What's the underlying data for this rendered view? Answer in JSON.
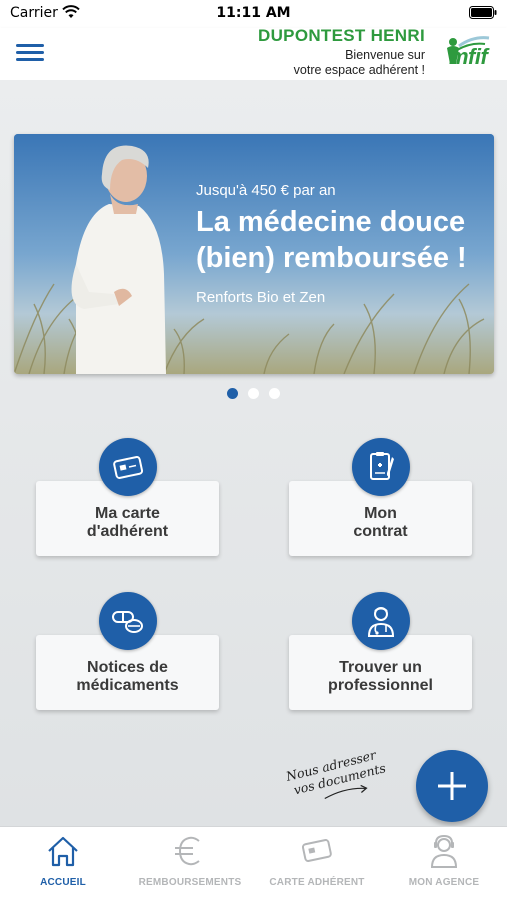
{
  "status_bar": {
    "carrier": "Carrier",
    "time": "11:11 AM"
  },
  "header": {
    "user_name": "DUPONTEST HENRI",
    "welcome_line1": "Bienvenue sur",
    "welcome_line2": "votre espace adhérent !",
    "logo_text": "mfif",
    "logo_color": "#2e9a3e"
  },
  "banner": {
    "kicker": "Jusqu'à 450 € par an",
    "title_line1": "La médecine douce",
    "title_line2": "(bien) remboursée !",
    "subtitle": "Renforts Bio et Zen",
    "pages": 3,
    "active_page": 1
  },
  "tiles": [
    {
      "label_line1": "Ma carte",
      "label_line2": "d'adhérent",
      "icon": "card-icon"
    },
    {
      "label_line1": "Mon",
      "label_line2": "contrat",
      "icon": "contract-icon"
    },
    {
      "label_line1": "Notices de",
      "label_line2": "médicaments",
      "icon": "pills-icon"
    },
    {
      "label_line1": "Trouver un",
      "label_line2": "professionnel",
      "icon": "doctor-icon"
    }
  ],
  "upload": {
    "hint_line1": "Nous adresser",
    "hint_line2": "vos documents",
    "fab_icon": "plus-icon"
  },
  "bottom_nav": [
    {
      "label": "ACCUEIL",
      "icon": "home-icon",
      "active": true
    },
    {
      "label": "REMBOURSEMENTS",
      "icon": "euro-icon",
      "active": false
    },
    {
      "label": "CARTE ADHÉRENT",
      "icon": "card-icon",
      "active": false
    },
    {
      "label": "MON AGENCE",
      "icon": "agent-icon",
      "active": false
    }
  ],
  "colors": {
    "primary": "#1f5fa8",
    "accent_green": "#2e9a3e",
    "inactive": "#b4b6b8"
  }
}
